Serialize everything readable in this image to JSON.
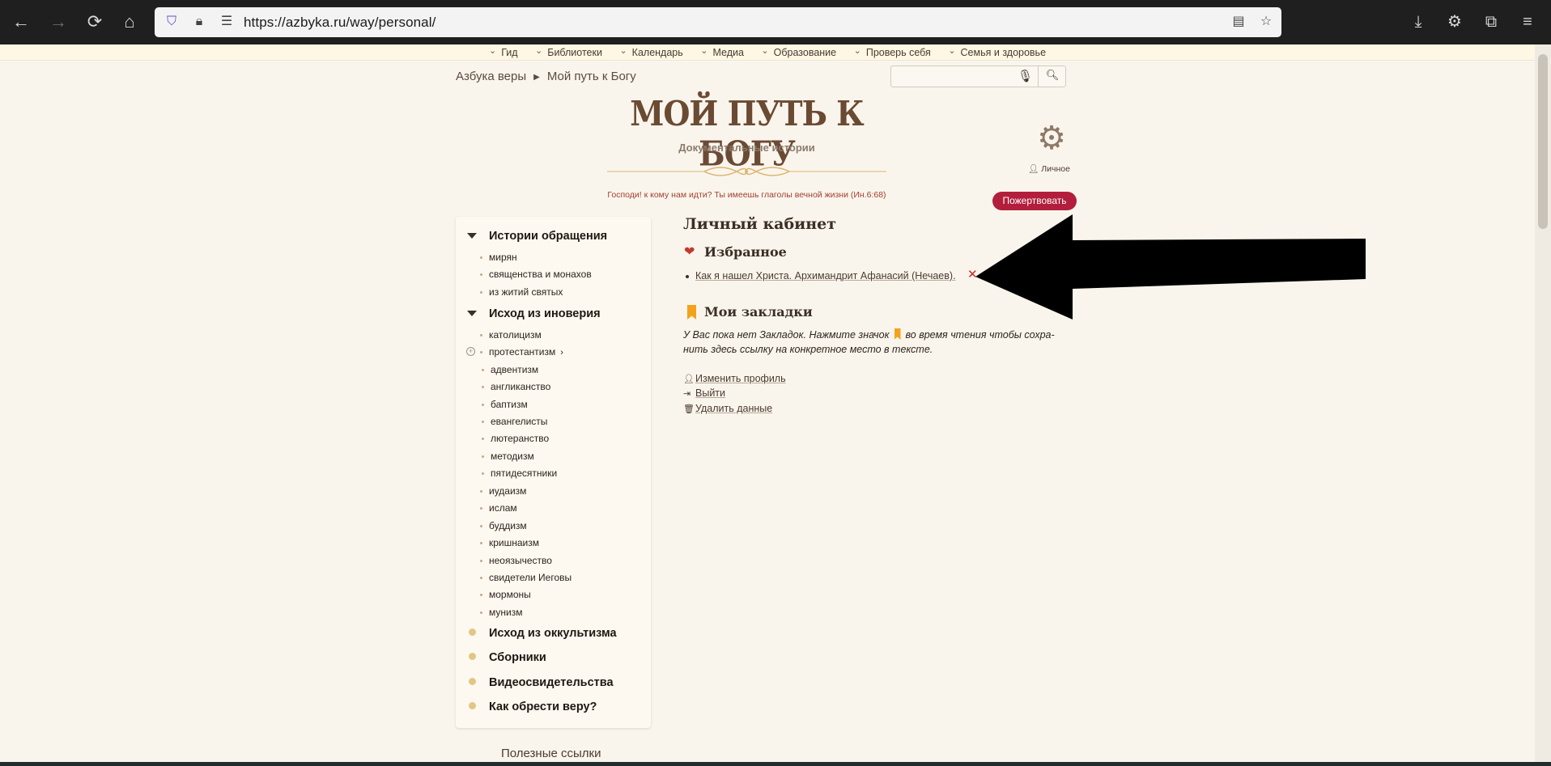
{
  "browser": {
    "url": "https://azbyka.ru/way/personal/"
  },
  "topnav": [
    "Гид",
    "Библиотеки",
    "Календарь",
    "Медиа",
    "Образование",
    "Проверь себя",
    "Семья и здоровье"
  ],
  "breadcrumb": {
    "root": "Азбука веры",
    "current": "Мой путь к Богу"
  },
  "search": {
    "placeholder": ""
  },
  "header": {
    "title": "МОЙ ПУТЬ К БОГУ",
    "subtitle": "Документальные истории",
    "verse": "Господи! к кому нам идти? Ты имеешь глаголы вечной жизни (Ин.6:68)",
    "personal_label": "Личное",
    "donate_label": "Пожертвовать"
  },
  "sidebar": {
    "sections": [
      {
        "title": "Истории обращения",
        "items": [
          "мирян",
          "священства и монахов",
          "из житий святых"
        ]
      },
      {
        "title": "Исход из иноверия",
        "items": [
          "католицизм",
          "протестантизм"
        ],
        "subitems": [
          "адвентизм",
          "англиканство",
          "баптизм",
          "евангелисты",
          "лютеранство",
          "методизм",
          "пятидесятники"
        ],
        "items_after": [
          "иудаизм",
          "ислам",
          "буддизм",
          "кришнаизм",
          "неоязычество",
          "свидетели Иеговы",
          "мормоны",
          "мунизм"
        ]
      },
      {
        "title": "Исход из оккультизма"
      },
      {
        "title": "Сборники"
      },
      {
        "title": "Видеосвидетельства"
      },
      {
        "title": "Как обрести веру?"
      }
    ],
    "useful_links": "Полезные ссылки"
  },
  "content": {
    "title": "Личный кабинет",
    "favorites_title": "Избранное",
    "favorites": [
      "Как я нашел Христа. Архимандрит Афанасий (Нечаев)."
    ],
    "bookmarks_title": "Мои закладки",
    "bookmarks_text_before": "У Вас пока нет Закладок. Нажмите значок",
    "bookmarks_text_after": "во время чтения чтобы сохра-нить здесь ссылку на конкретное место в тексте.",
    "edit_profile": "Изменить профиль",
    "logout": "Выйти",
    "delete_data": "Удалить данные"
  },
  "colors": {
    "accent": "#b21e3b",
    "title_brown": "#6b4a33",
    "bookmark_orange": "#f2a31b",
    "background": "#faf5ec"
  }
}
